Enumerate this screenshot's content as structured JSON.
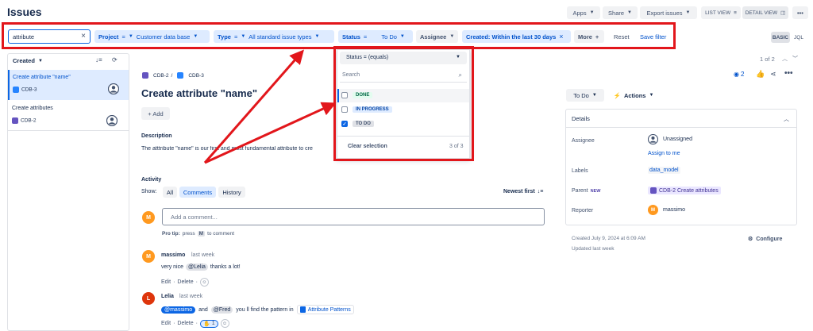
{
  "page": {
    "title": "Issues"
  },
  "topbar": {
    "apps": "Apps",
    "share": "Share",
    "export": "Export issues",
    "list_view": "LIST VIEW",
    "detail_view": "DETAIL VIEW",
    "more": "•••"
  },
  "filters": {
    "search_value": "attribute",
    "project_label": "Project",
    "project_op": "=",
    "project_value": "Customer data base",
    "type_label": "Type",
    "type_op": "=",
    "type_value": "All standard issue types",
    "status_label": "Status",
    "status_op": "=",
    "status_value": "To Do",
    "assignee_label": "Assignee",
    "created_label": "Created: Within the last 30 days",
    "more_label": "More",
    "reset": "Reset",
    "save": "Save filter",
    "basic": "BASIC",
    "jql": "JQL"
  },
  "list": {
    "sort_label": "Created",
    "items": [
      {
        "title": "Create attribute \"name\"",
        "key": "CDB-3"
      },
      {
        "title": "Create attributes",
        "key": "CDB-2"
      }
    ]
  },
  "pagination": "1 of 2",
  "issue": {
    "breadcrumb_parent": "CDB-2",
    "breadcrumb_sep": "/",
    "breadcrumb_key": "CDB-3",
    "title": "Create attribute \"name\"",
    "add_button": "+ Add",
    "description_heading": "Description",
    "description_text": "The atttribute \"name\" is our first and most fundamental attribute to cre",
    "watchers": "2"
  },
  "activity": {
    "heading": "Activity",
    "show_label": "Show:",
    "tabs": [
      "All",
      "Comments",
      "History"
    ],
    "sort": "Newest first",
    "comment_placeholder": "Add a comment...",
    "pro_tip_prefix": "Pro tip:",
    "pro_tip_press": "press",
    "pro_tip_key": "M",
    "pro_tip_suffix": "to comment",
    "current_user_initial": "M",
    "comments": [
      {
        "initial": "M",
        "author": "massimo",
        "time": "last week",
        "text_before": "very nice",
        "mention": "@Lelia",
        "text_after": "thanks a lot!",
        "edit": "Edit",
        "delete": "Delete"
      },
      {
        "initial": "L",
        "author": "Lelia",
        "time": "last week",
        "mention1": "@massimo",
        "and": "and",
        "mention2": "@Fred",
        "text": "you ll find the pattern in",
        "page_link": "Attribute Patterns",
        "edit": "Edit",
        "delete": "Delete",
        "reaction_count": "1"
      }
    ]
  },
  "status_dropdown": {
    "header": "Status = (equals)",
    "search_placeholder": "Search",
    "options": [
      {
        "label": "DONE",
        "checked": false,
        "color": "#e3fcef",
        "text_color": "#006644"
      },
      {
        "label": "IN PROGRESS",
        "checked": false,
        "color": "#deebff",
        "text_color": "#0747a6"
      },
      {
        "label": "TO DO",
        "checked": true,
        "color": "#dfe1e6",
        "text_color": "#42526e"
      }
    ],
    "clear": "Clear selection",
    "count": "3 of 3"
  },
  "sidepanel": {
    "status_button": "To Do",
    "actions_button": "Actions",
    "details_heading": "Details",
    "assignee_label": "Assignee",
    "assignee_value": "Unassigned",
    "assign_to_me": "Assign to me",
    "labels_label": "Labels",
    "labels_value": "data_model",
    "parent_label": "Parent",
    "parent_badge": "NEW",
    "parent_value": "CDB-2 Create attributes",
    "reporter_label": "Reporter",
    "reporter_initial": "M",
    "reporter_value": "massimo",
    "created": "Created July 9, 2024 at 6:09 AM",
    "updated": "Updated last week",
    "configure": "Configure"
  },
  "colors": {
    "accent": "#0052cc",
    "annotation_red": "#e2161b",
    "selected_bg": "#deebff",
    "avatar_orange": "#ff991f",
    "avatar_red": "#de350b"
  }
}
